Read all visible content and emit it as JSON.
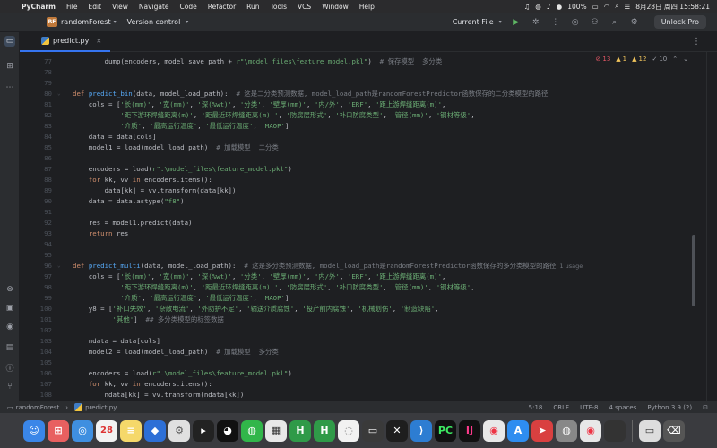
{
  "menubar": {
    "app_name": "PyCharm",
    "items": [
      "File",
      "Edit",
      "View",
      "Navigate",
      "Code",
      "Refactor",
      "Run",
      "Tools",
      "VCS",
      "Window",
      "Help"
    ],
    "battery": "100%",
    "clock": "8月28日 周四 15:58:21"
  },
  "toolbar": {
    "project_badge": "RF",
    "project_name": "randomForest",
    "version_control": "Version control",
    "run_config": "Current File",
    "unlock_label": "Unlock Pro"
  },
  "tab": {
    "label": "predict.py"
  },
  "inspections": {
    "errors": "13",
    "warnings": "1",
    "weak_warnings": "12",
    "typos": "10"
  },
  "code_lines": [
    {
      "n": "77",
      "text": "        dump(encoders, model_save_path + r\"\\model_files\\feature_model.pkl\")  # 保存模型  多分类"
    },
    {
      "n": "78",
      "text": ""
    },
    {
      "n": "79",
      "text": ""
    },
    {
      "n": "80",
      "text": "def predict_bin(data, model_load_path):  # 这是二分类预测数据, model_load_path是randomForestPredictor函数保存的二分类模型的路径"
    },
    {
      "n": "81",
      "text": "    cols = ['长(mm)', '宽(mm)', '深(%wt)', '分类', '壁厚(mm)', '内/外', 'ERF', '距上游焊缝距离(m)',"
    },
    {
      "n": "82",
      "text": "            '距下游环焊缝距离(m)', '距最近环焊缝距离(m) ', '防腐层形式', '补口防腐类型', '管径(mm)', '钢材等级',"
    },
    {
      "n": "83",
      "text": "            '介质', '最高运行温度', '最低运行温度', 'MAOP']"
    },
    {
      "n": "84",
      "text": "    data = data[cols]"
    },
    {
      "n": "85",
      "text": "    model1 = load(model_load_path)  # 加载模型  二分类"
    },
    {
      "n": "86",
      "text": ""
    },
    {
      "n": "87",
      "text": "    encoders = load(r\".\\model_files\\feature_model.pkl\")"
    },
    {
      "n": "88",
      "text": "    for kk, vv in encoders.items():"
    },
    {
      "n": "89",
      "text": "        data[kk] = vv.transform(data[kk])"
    },
    {
      "n": "90",
      "text": "    data = data.astype(\"f8\")"
    },
    {
      "n": "91",
      "text": ""
    },
    {
      "n": "92",
      "text": "    res = model1.predict(data)"
    },
    {
      "n": "93",
      "text": "    return res"
    },
    {
      "n": "94",
      "text": ""
    },
    {
      "n": "95",
      "text": ""
    },
    {
      "n": "96",
      "text": "def predict_multi(data, model_load_path):  # 这是多分类预测数据, model_load_path是randomForestPredictor函数保存的多分类模型的路径"
    },
    {
      "n": "97",
      "text": "    cols = ['长(mm)', '宽(mm)', '深(%wt)', '分类', '壁厚(mm)', '内/外', 'ERF', '距上游焊缝距离(m)',"
    },
    {
      "n": "98",
      "text": "            '距下游环焊缝距离(m)', '距最近环焊缝距离(m) ', '防腐层形式', '补口防腐类型', '管径(mm)', '钢材等级',"
    },
    {
      "n": "99",
      "text": "            '介质', '最高运行温度', '最低运行温度', 'MAOP']"
    },
    {
      "n": "100",
      "text": "    y8 = ['补口失效', '杂散电流', '外防护不足', '输送介质腐蚀', '投产前内腐蚀', '机械划伤', '制造缺陷',"
    },
    {
      "n": "101",
      "text": "          '其他']  ## 多分类模型的标签数据"
    },
    {
      "n": "102",
      "text": ""
    },
    {
      "n": "103",
      "text": "    ndata = data[cols]"
    },
    {
      "n": "104",
      "text": "    model2 = load(model_load_path)  # 加载模型  多分类"
    },
    {
      "n": "105",
      "text": ""
    },
    {
      "n": "106",
      "text": "    encoders = load(r\".\\model_files\\feature_model.pkl\")"
    },
    {
      "n": "107",
      "text": "    for kk, vv in encoders.items():"
    },
    {
      "n": "108",
      "text": "        ndata[kk] = vv.transform(ndata[kk])"
    }
  ],
  "usage_hint": "1 usage",
  "statusbar": {
    "project": "randomForest",
    "file": "predict.py",
    "position": "5:18",
    "line_sep": "CRLF",
    "encoding": "UTF-8",
    "indent": "4 spaces",
    "interpreter": "Python 3.9 (2)"
  },
  "dock": {
    "calendar_day": "28"
  }
}
